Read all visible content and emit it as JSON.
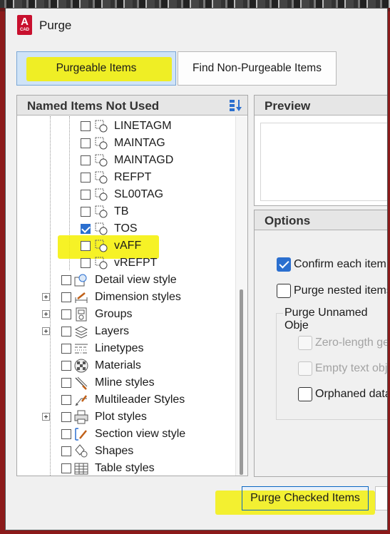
{
  "window": {
    "title": "Purge",
    "app_icon_letter": "A",
    "app_icon_caption": "CAD"
  },
  "tabs": {
    "active_label": "Purgeable Items",
    "other_label": "Find Non-Purgeable Items"
  },
  "left_panel": {
    "header": "Named Items Not Used",
    "sub_items": [
      {
        "label": "LINETAGM",
        "checked": false
      },
      {
        "label": "MAINTAG",
        "checked": false
      },
      {
        "label": "MAINTAGD",
        "checked": false
      },
      {
        "label": "REFPT",
        "checked": false
      },
      {
        "label": "SL00TAG",
        "checked": false
      },
      {
        "label": "TB",
        "checked": false
      },
      {
        "label": "TOS",
        "checked": true
      },
      {
        "label": "vAFF",
        "checked": false
      },
      {
        "label": "vREFPT",
        "checked": false
      }
    ],
    "categories": [
      {
        "label": "Detail view style",
        "icon": "detail-view-icon",
        "expandable": false
      },
      {
        "label": "Dimension styles",
        "icon": "dimension-icon",
        "expandable": true
      },
      {
        "label": "Groups",
        "icon": "groups-icon",
        "expandable": true
      },
      {
        "label": "Layers",
        "icon": "layers-icon",
        "expandable": true
      },
      {
        "label": "Linetypes",
        "icon": "linetypes-icon",
        "expandable": false
      },
      {
        "label": "Materials",
        "icon": "materials-icon",
        "expandable": false
      },
      {
        "label": "Mline styles",
        "icon": "mline-icon",
        "expandable": false
      },
      {
        "label": "Multileader Styles",
        "icon": "multileader-icon",
        "expandable": false
      },
      {
        "label": "Plot styles",
        "icon": "plot-styles-icon",
        "expandable": true
      },
      {
        "label": "Section view style",
        "icon": "section-view-icon",
        "expandable": false
      },
      {
        "label": "Shapes",
        "icon": "shapes-icon",
        "expandable": false
      },
      {
        "label": "Table styles",
        "icon": "table-styles-icon",
        "expandable": false
      }
    ]
  },
  "preview_panel": {
    "header": "Preview"
  },
  "options_panel": {
    "header": "Options",
    "confirm_each_item": "Confirm each item",
    "purge_nested_items": "Purge nested items",
    "group_title": "Purge Unnamed Obje",
    "zero_length": "Zero-length ge",
    "empty_text": "Empty text obj",
    "orphaned": "Orphaned data"
  },
  "buttons": {
    "purge_checked": "Purge Checked Items"
  },
  "colors": {
    "highlight": "#f4f000",
    "accent": "#2b6fcf",
    "brand": "#c8102e"
  }
}
